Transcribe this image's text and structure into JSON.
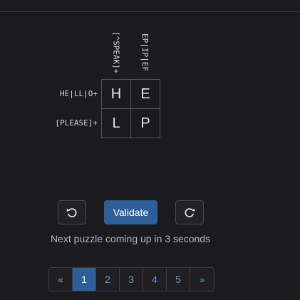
{
  "puzzle": {
    "col_clues": [
      "[^SPEAK]+",
      "EP|IP|EF"
    ],
    "row_clues": [
      "HE|LL|O+",
      "[PLEASE]+"
    ],
    "cells": [
      [
        "H",
        "E"
      ],
      [
        "L",
        "P"
      ]
    ]
  },
  "controls": {
    "undo_icon": "undo-icon",
    "redo_icon": "redo-icon",
    "validate_label": "Validate"
  },
  "status": "Next puzzle coming up in 3 seconds",
  "pagination": {
    "prev": "«",
    "pages": [
      "1",
      "2",
      "3",
      "4",
      "5"
    ],
    "next": "»",
    "active": "1"
  },
  "colors": {
    "background": "#1b1b1d",
    "accent": "#2f5f9a",
    "link": "#5b9bd5"
  }
}
